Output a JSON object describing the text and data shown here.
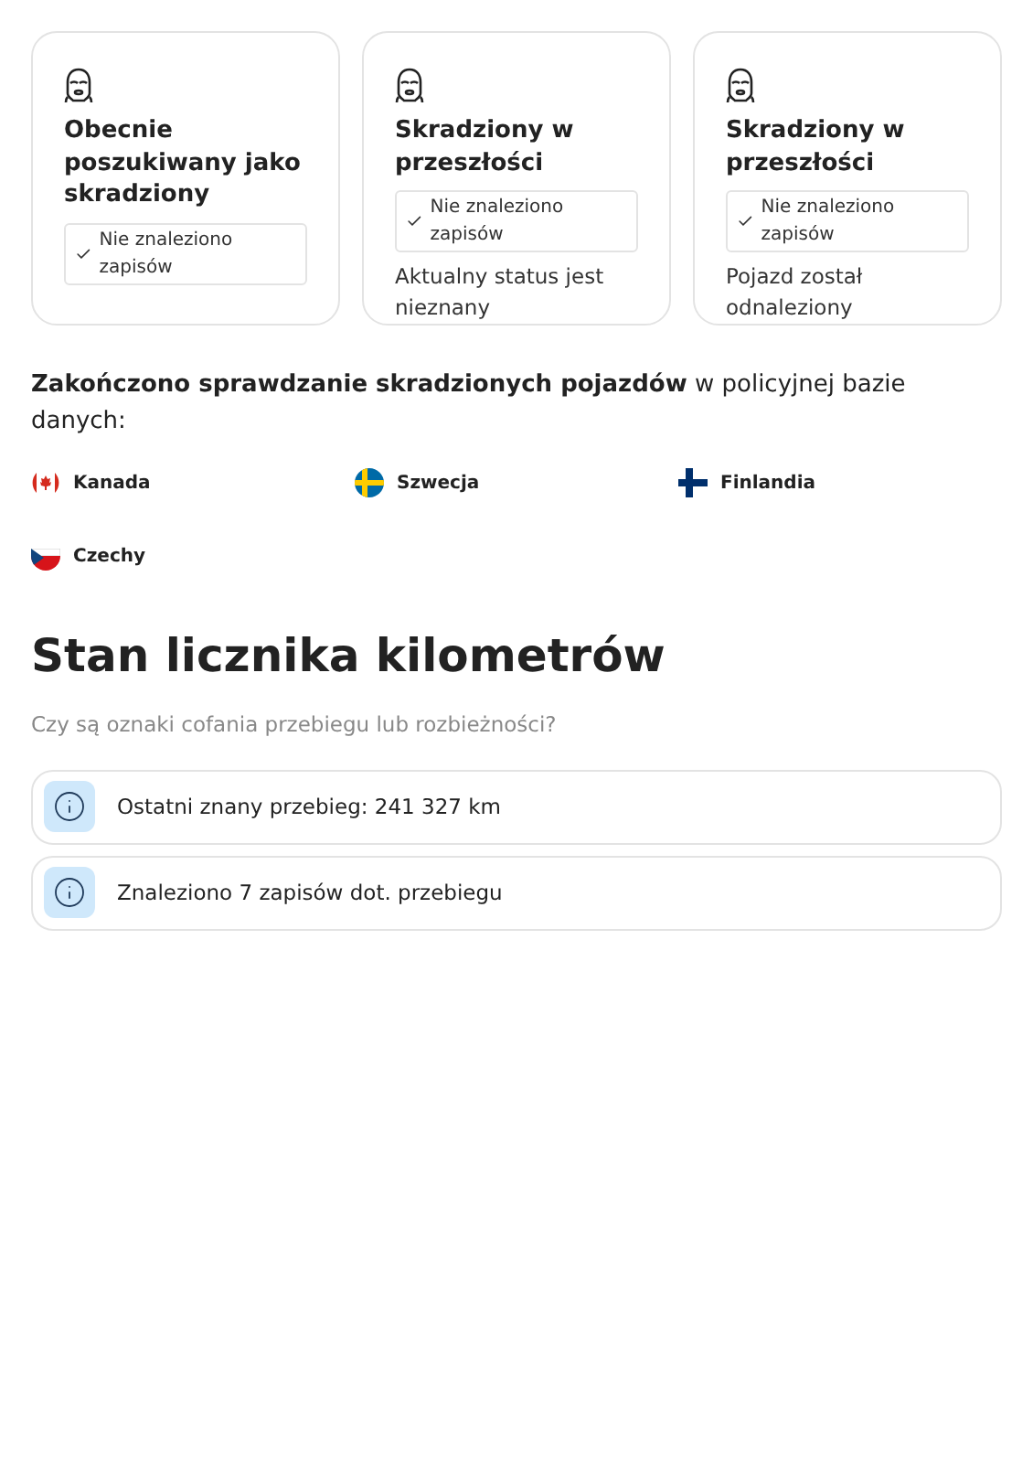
{
  "cards": [
    {
      "title": "Obecnie poszukiwany jako skradziony",
      "badge": "Nie znaleziono zapisów"
    },
    {
      "title": "Skradziony w przeszłości",
      "badge": "Nie znaleziono zapisów",
      "note": "Aktualny status jest nieznany"
    },
    {
      "title": "Skradziony w przeszłości",
      "badge": "Nie znaleziono zapisów",
      "note": "Pojazd został odnaleziony"
    }
  ],
  "check_summary": "**Zakończono sprawdzanie skradzionych pojazdów** w policyjnej bazie danych:",
  "countries": [
    {
      "name": "Kanada",
      "kind": "canada"
    },
    {
      "name": "Szwecja",
      "kind": "sweden"
    },
    {
      "name": "Finlandia",
      "kind": "finland"
    },
    {
      "name": "Czechy",
      "kind": "czech"
    }
  ],
  "odometer": {
    "title": "Stan licznika kilometrów",
    "subtitle": "Czy są oznaki cofania przebiegu lub rozbieżności?",
    "items": [
      "Ostatni znany przebieg: 241 327 km",
      "Znaleziono 7 zapisów dot. przebiegu"
    ]
  }
}
